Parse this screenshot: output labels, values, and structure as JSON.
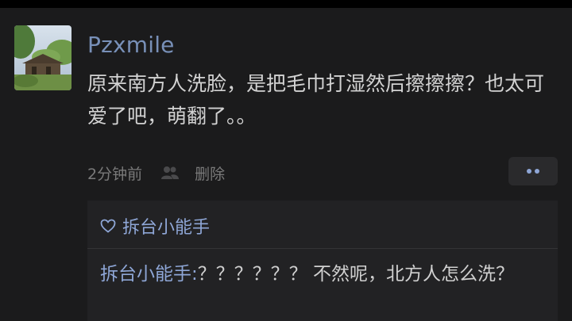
{
  "post": {
    "username": "Pzxmile",
    "text": "原来南方人洗脸，是把毛巾打湿然后擦擦擦？也太可爱了吧，萌翻了。。",
    "time": "2分钟前",
    "delete_label": "删除",
    "avatar_icon": "landscape-photo-avatar",
    "more_icon": "more-dots-icon"
  },
  "replies": {
    "liked_by": "拆台小能手",
    "items": [
      {
        "author": "拆台小能手",
        "separator": ":",
        "text": "？？？？？？ 不然呢，北方人怎么洗？"
      }
    ]
  },
  "colors": {
    "background": "#1b1b1c",
    "username": "#7890b8",
    "link": "#8ea6d6",
    "text": "#d2d2d2",
    "meta": "#7a7a7a"
  }
}
